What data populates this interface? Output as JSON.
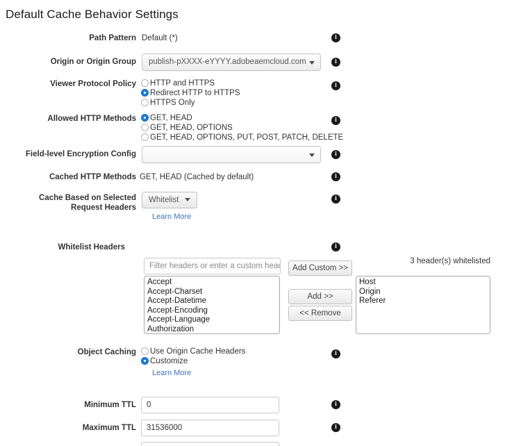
{
  "page": {
    "title": "Default Cache Behavior Settings"
  },
  "icons": {
    "info": "i",
    "info_name": "info-icon",
    "caret": "chevron-down-icon"
  },
  "colors": {
    "accent_radio": "#1f7fd8",
    "link": "#3b73c4",
    "label": "#333333",
    "background": "#ffffff"
  },
  "fields": {
    "path_pattern": {
      "label": "Path Pattern",
      "value": "Default (*)"
    },
    "origin_or_origin_group": {
      "label": "Origin or Origin Group",
      "value": "publish-pXXXX-eYYYY.adobeaemcloud.com"
    },
    "viewer_protocol_policy": {
      "label": "Viewer Protocol Policy",
      "options": [
        {
          "label": "HTTP and HTTPS",
          "selected": false
        },
        {
          "label": "Redirect HTTP to HTTPS",
          "selected": true
        },
        {
          "label": "HTTPS Only",
          "selected": false
        }
      ]
    },
    "allowed_http_methods": {
      "label": "Allowed HTTP Methods",
      "options": [
        {
          "label": "GET, HEAD",
          "selected": true
        },
        {
          "label": "GET, HEAD, OPTIONS",
          "selected": false
        },
        {
          "label": "GET, HEAD, OPTIONS, PUT, POST, PATCH, DELETE",
          "selected": false
        }
      ]
    },
    "field_level_encryption_config": {
      "label": "Field-level Encryption Config",
      "value": ""
    },
    "cached_http_methods": {
      "label": "Cached HTTP Methods",
      "value": "GET, HEAD (Cached by default)"
    },
    "cache_based_on_selected_request_headers": {
      "label_line1": "Cache Based on Selected",
      "label_line2": "Request Headers",
      "value": "Whitelist",
      "learn_more": "Learn More"
    },
    "whitelist_headers": {
      "label": "Whitelist Headers",
      "filter_placeholder": "Filter headers or enter a custom header",
      "filter_value": "",
      "add_custom_button": "Add Custom >>",
      "add_button": "Add >>",
      "remove_button": "<< Remove",
      "counter": "3 header(s) whitelisted",
      "available": [
        "Accept",
        "Accept-Charset",
        "Accept-Datetime",
        "Accept-Encoding",
        "Accept-Language",
        "Authorization"
      ],
      "whitelisted": [
        "Host",
        "Origin",
        "Referer"
      ]
    },
    "object_caching": {
      "label": "Object Caching",
      "options": [
        {
          "label": "Use Origin Cache Headers",
          "selected": false
        },
        {
          "label": "Customize",
          "selected": true
        }
      ],
      "learn_more": "Learn More"
    },
    "minimum_ttl": {
      "label": "Minimum TTL",
      "value": "0"
    },
    "maximum_ttl": {
      "label": "Maximum TTL",
      "value": "31536000"
    }
  }
}
